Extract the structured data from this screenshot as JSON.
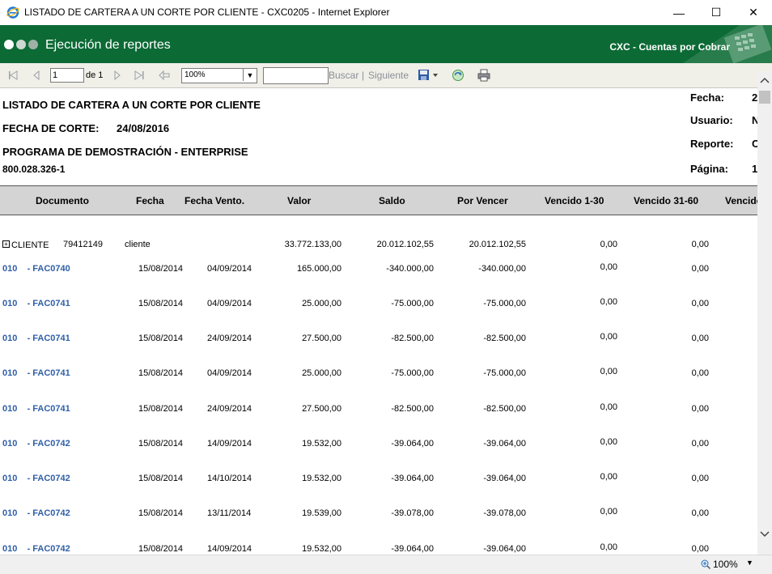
{
  "window": {
    "title": "LISTADO DE CARTERA A UN CORTE POR CLIENTE - CXC0205 - Internet Explorer",
    "minimize": "—",
    "maximize": "☐",
    "close": "✕"
  },
  "banner": {
    "app_title": "Ejecución de reportes",
    "module": "CXC - Cuentas por Cobrar",
    "color": "#0c6a35"
  },
  "toolbar": {
    "page_value": "1",
    "of_label": "de 1",
    "zoom_value": "100%",
    "search_value": "",
    "search_label": "Buscar",
    "separator": "|",
    "next_label": "Siguiente"
  },
  "report": {
    "title": "LISTADO DE CARTERA A UN CORTE POR CLIENTE",
    "cutoff_label": "FECHA DE CORTE:",
    "cutoff_value": "24/08/2016",
    "company": "PROGRAMA DE DEMOSTRACIÓN - ENTERPRISE",
    "nit": "800.028.326-1",
    "meta": {
      "fecha_label": "Fecha:",
      "fecha_value": "2",
      "usuario_label": "Usuario:",
      "usuario_value": "N",
      "reporte_label": "Reporte:",
      "reporte_value": "C",
      "pagina_label": "Página:",
      "pagina_value": "1"
    },
    "columns": [
      "Documento",
      "Fecha",
      "Fecha Vento.",
      "Valor",
      "Saldo",
      "Por Vencer",
      "Vencido 1-30",
      "Vencido 31-60",
      "Vencido"
    ],
    "client": {
      "label": "CLIENTE",
      "id": "79412149",
      "name": "cliente",
      "valor": "33.772.133,00",
      "saldo": "20.012.102,55",
      "por_vencer": "20.012.102,55",
      "v1_30": "0,00",
      "v31_60": "0,00"
    },
    "rows": [
      {
        "doc": "010    - FAC0740",
        "fecha": "15/08/2014",
        "vence": "04/09/2014",
        "valor": "165.000,00",
        "saldo": "-340.000,00",
        "por_vencer": "-340.000,00",
        "v1_30": "0,00",
        "v31_60": "0,00"
      },
      {
        "doc": "010    - FAC0741",
        "fecha": "15/08/2014",
        "vence": "04/09/2014",
        "valor": "25.000,00",
        "saldo": "-75.000,00",
        "por_vencer": "-75.000,00",
        "v1_30": "0,00",
        "v31_60": "0,00"
      },
      {
        "doc": "010    - FAC0741",
        "fecha": "15/08/2014",
        "vence": "24/09/2014",
        "valor": "27.500,00",
        "saldo": "-82.500,00",
        "por_vencer": "-82.500,00",
        "v1_30": "0,00",
        "v31_60": "0,00"
      },
      {
        "doc": "010    - FAC0741",
        "fecha": "15/08/2014",
        "vence": "04/09/2014",
        "valor": "25.000,00",
        "saldo": "-75.000,00",
        "por_vencer": "-75.000,00",
        "v1_30": "0,00",
        "v31_60": "0,00"
      },
      {
        "doc": "010    - FAC0741",
        "fecha": "15/08/2014",
        "vence": "24/09/2014",
        "valor": "27.500,00",
        "saldo": "-82.500,00",
        "por_vencer": "-82.500,00",
        "v1_30": "0,00",
        "v31_60": "0,00"
      },
      {
        "doc": "010    - FAC0742",
        "fecha": "15/08/2014",
        "vence": "14/09/2014",
        "valor": "19.532,00",
        "saldo": "-39.064,00",
        "por_vencer": "-39.064,00",
        "v1_30": "0,00",
        "v31_60": "0,00"
      },
      {
        "doc": "010    - FAC0742",
        "fecha": "15/08/2014",
        "vence": "14/10/2014",
        "valor": "19.532,00",
        "saldo": "-39.064,00",
        "por_vencer": "-39.064,00",
        "v1_30": "0,00",
        "v31_60": "0,00"
      },
      {
        "doc": "010    - FAC0742",
        "fecha": "15/08/2014",
        "vence": "13/11/2014",
        "valor": "19.539,00",
        "saldo": "-39.078,00",
        "por_vencer": "-39.078,00",
        "v1_30": "0,00",
        "v31_60": "0,00"
      },
      {
        "doc": "010    - FAC0742",
        "fecha": "15/08/2014",
        "vence": "14/09/2014",
        "valor": "19.532,00",
        "saldo": "-39.064,00",
        "por_vencer": "-39.064,00",
        "v1_30": "0,00",
        "v31_60": "0,00"
      }
    ]
  },
  "statusbar": {
    "zoom": "100%"
  },
  "colors": {
    "doc_link": "#2f5fa8",
    "header_bg": "#d4d4d4",
    "toolbar_bg": "#f0efe8"
  }
}
